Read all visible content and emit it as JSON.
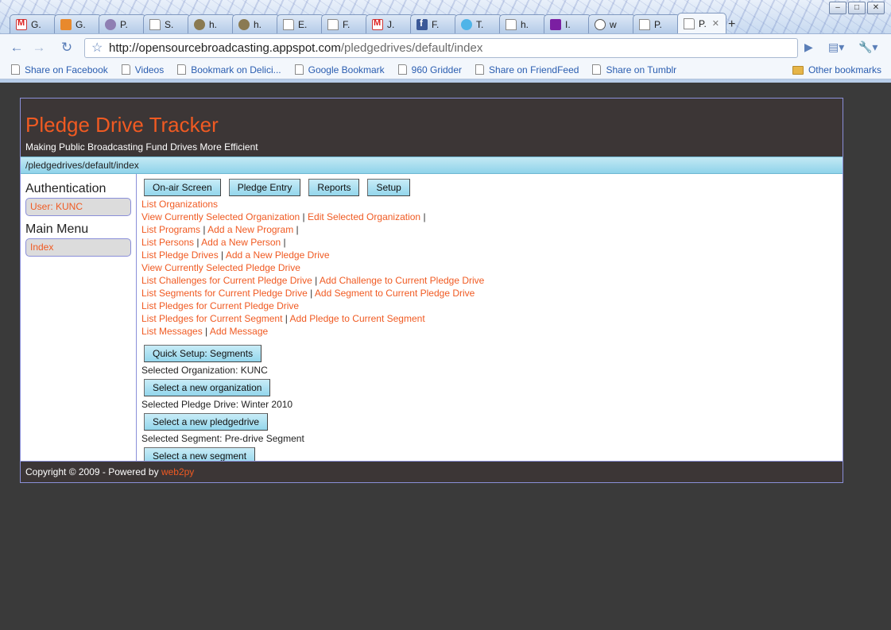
{
  "browser": {
    "tabs": [
      {
        "label": "G.",
        "icon": "gmail-icon"
      },
      {
        "label": "G.",
        "icon": "rss-icon"
      },
      {
        "label": "P.",
        "icon": "circle-icon"
      },
      {
        "label": "S.",
        "icon": "page-icon"
      },
      {
        "label": "h.",
        "icon": "seal-icon"
      },
      {
        "label": "h.",
        "icon": "seal-icon"
      },
      {
        "label": "E.",
        "icon": "page-icon"
      },
      {
        "label": "F.",
        "icon": "page-icon"
      },
      {
        "label": "J.",
        "icon": "gmail-icon"
      },
      {
        "label": "F.",
        "icon": "facebook-icon"
      },
      {
        "label": "T.",
        "icon": "twitter-icon"
      },
      {
        "label": "h.",
        "icon": "page-icon"
      },
      {
        "label": "I.",
        "icon": "yahoo-icon"
      },
      {
        "label": "w",
        "icon": "chat-icon"
      },
      {
        "label": "P.",
        "icon": "page-icon"
      },
      {
        "label": "P.",
        "icon": "page-icon",
        "active": true
      }
    ],
    "url_host": "http://opensourcebroadcasting.appspot.com",
    "url_path": "/pledgedrives/default/index",
    "bookmarks": [
      {
        "label": "Share on Facebook"
      },
      {
        "label": "Videos"
      },
      {
        "label": "Bookmark on Delici..."
      },
      {
        "label": "Google Bookmark"
      },
      {
        "label": "960 Gridder"
      },
      {
        "label": "Share on FriendFeed"
      },
      {
        "label": "Share on Tumblr"
      }
    ],
    "other_bookmarks": "Other bookmarks"
  },
  "site": {
    "title": "Pledge Drive Tracker",
    "subtitle": "Making Public Broadcasting Fund Drives More Efficient",
    "breadcrumb": "/pledgedrives/default/index"
  },
  "sidebar": {
    "auth_heading": "Authentication",
    "user_button": "User: KUNC",
    "menu_heading": "Main Menu",
    "index_button": "Index"
  },
  "main": {
    "top_buttons": [
      "On-air Screen",
      "Pledge Entry",
      "Reports",
      "Setup"
    ],
    "link_lines": [
      [
        "List Organizations"
      ],
      [
        "View Currently Selected Organization",
        "Edit Selected Organization",
        ""
      ],
      [
        "List Programs",
        "Add a New Program",
        ""
      ],
      [
        "List Persons",
        "Add a New Person",
        ""
      ],
      [
        "List Pledge Drives",
        "Add a New Pledge Drive"
      ],
      [
        "View Currently Selected Pledge Drive"
      ],
      [
        "List Challenges for Current Pledge Drive",
        "Add Challenge to Current Pledge Drive"
      ],
      [
        "List Segments for Current Pledge Drive",
        "Add Segment to Current Pledge Drive"
      ],
      [
        "List Pledges for Current Pledge Drive"
      ],
      [
        "List Pledges for Current Segment",
        "Add Pledge to Current Segment"
      ],
      [
        "List Messages",
        "Add Message"
      ]
    ],
    "quick_setup": "Quick Setup: Segments",
    "selected_org": "Selected Organization: KUNC",
    "select_org_btn": "Select a new organization",
    "selected_drive": "Selected Pledge Drive: Winter 2010",
    "select_drive_btn": "Select a new pledgedrive",
    "selected_segment": "Selected Segment: Pre-drive Segment",
    "select_segment_btn": "Select a new segment"
  },
  "footer": {
    "text": "Copyright © 2009 - Powered by ",
    "link": "web2py"
  },
  "colors": {
    "accent": "#f05a22",
    "header_bg": "#3c3636",
    "button_bg": "#93d6ec"
  }
}
